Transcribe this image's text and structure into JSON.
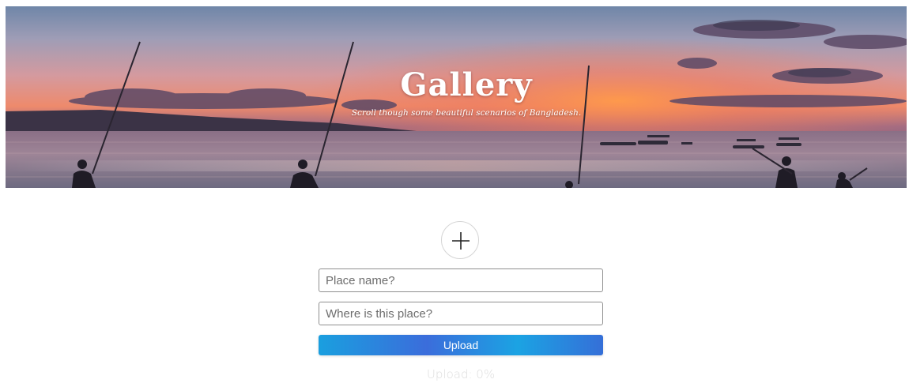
{
  "header": {
    "title": "Gallery",
    "subtitle": "Scroll though some beautiful scenarios of Bangladesh."
  },
  "form": {
    "add_icon": "plus-icon",
    "place_name": {
      "value": "",
      "placeholder": "Place name?"
    },
    "place_location": {
      "value": "",
      "placeholder": "Where is this place?"
    },
    "upload_label": "Upload",
    "status_text": "Upload: 0%",
    "progress_percent": 0
  },
  "colors": {
    "button_gradient_start": "#1a9fdf",
    "button_gradient_mid": "#3b6ddb",
    "status_text": "#dddddd",
    "field_border": "#8f8f8f"
  }
}
